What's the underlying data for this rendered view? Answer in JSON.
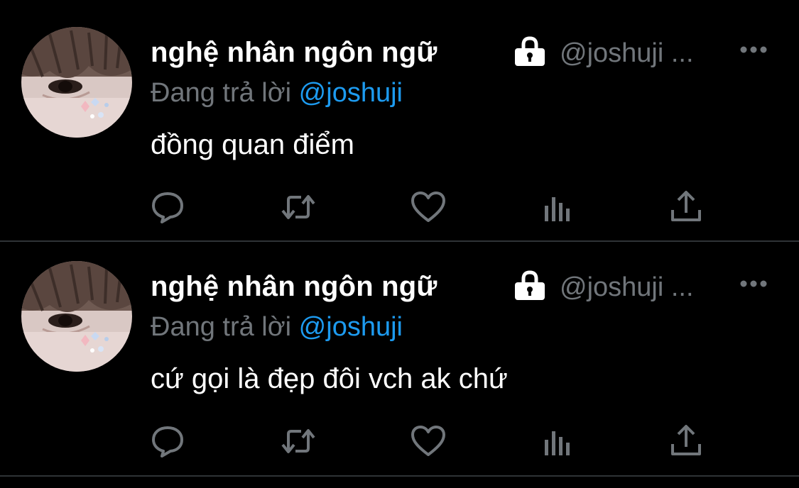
{
  "colors": {
    "background": "#000000",
    "name": "#ffffff",
    "secondary": "#71767b",
    "mention": "#1d9bf0",
    "divider": "#2f3336"
  },
  "tweets": [
    {
      "display_name": "nghệ nhân ngôn ngữ",
      "handle": "@joshuji ...",
      "replying_prefix": "Đang trả lời",
      "replying_to": "@joshuji",
      "text": "đồng quan điểm",
      "icons": [
        "avatar",
        "lock-icon",
        "more-icon",
        "reply-icon",
        "retweet-icon",
        "like-icon",
        "views-icon",
        "share-icon"
      ]
    },
    {
      "display_name": "nghệ nhân ngôn ngữ",
      "handle": "@joshuji ...",
      "replying_prefix": "Đang trả lời",
      "replying_to": "@joshuji",
      "text": "cứ gọi là đẹp đôi vch ak chứ",
      "icons": [
        "avatar",
        "lock-icon",
        "more-icon",
        "reply-icon",
        "retweet-icon",
        "like-icon",
        "views-icon",
        "share-icon"
      ]
    }
  ]
}
